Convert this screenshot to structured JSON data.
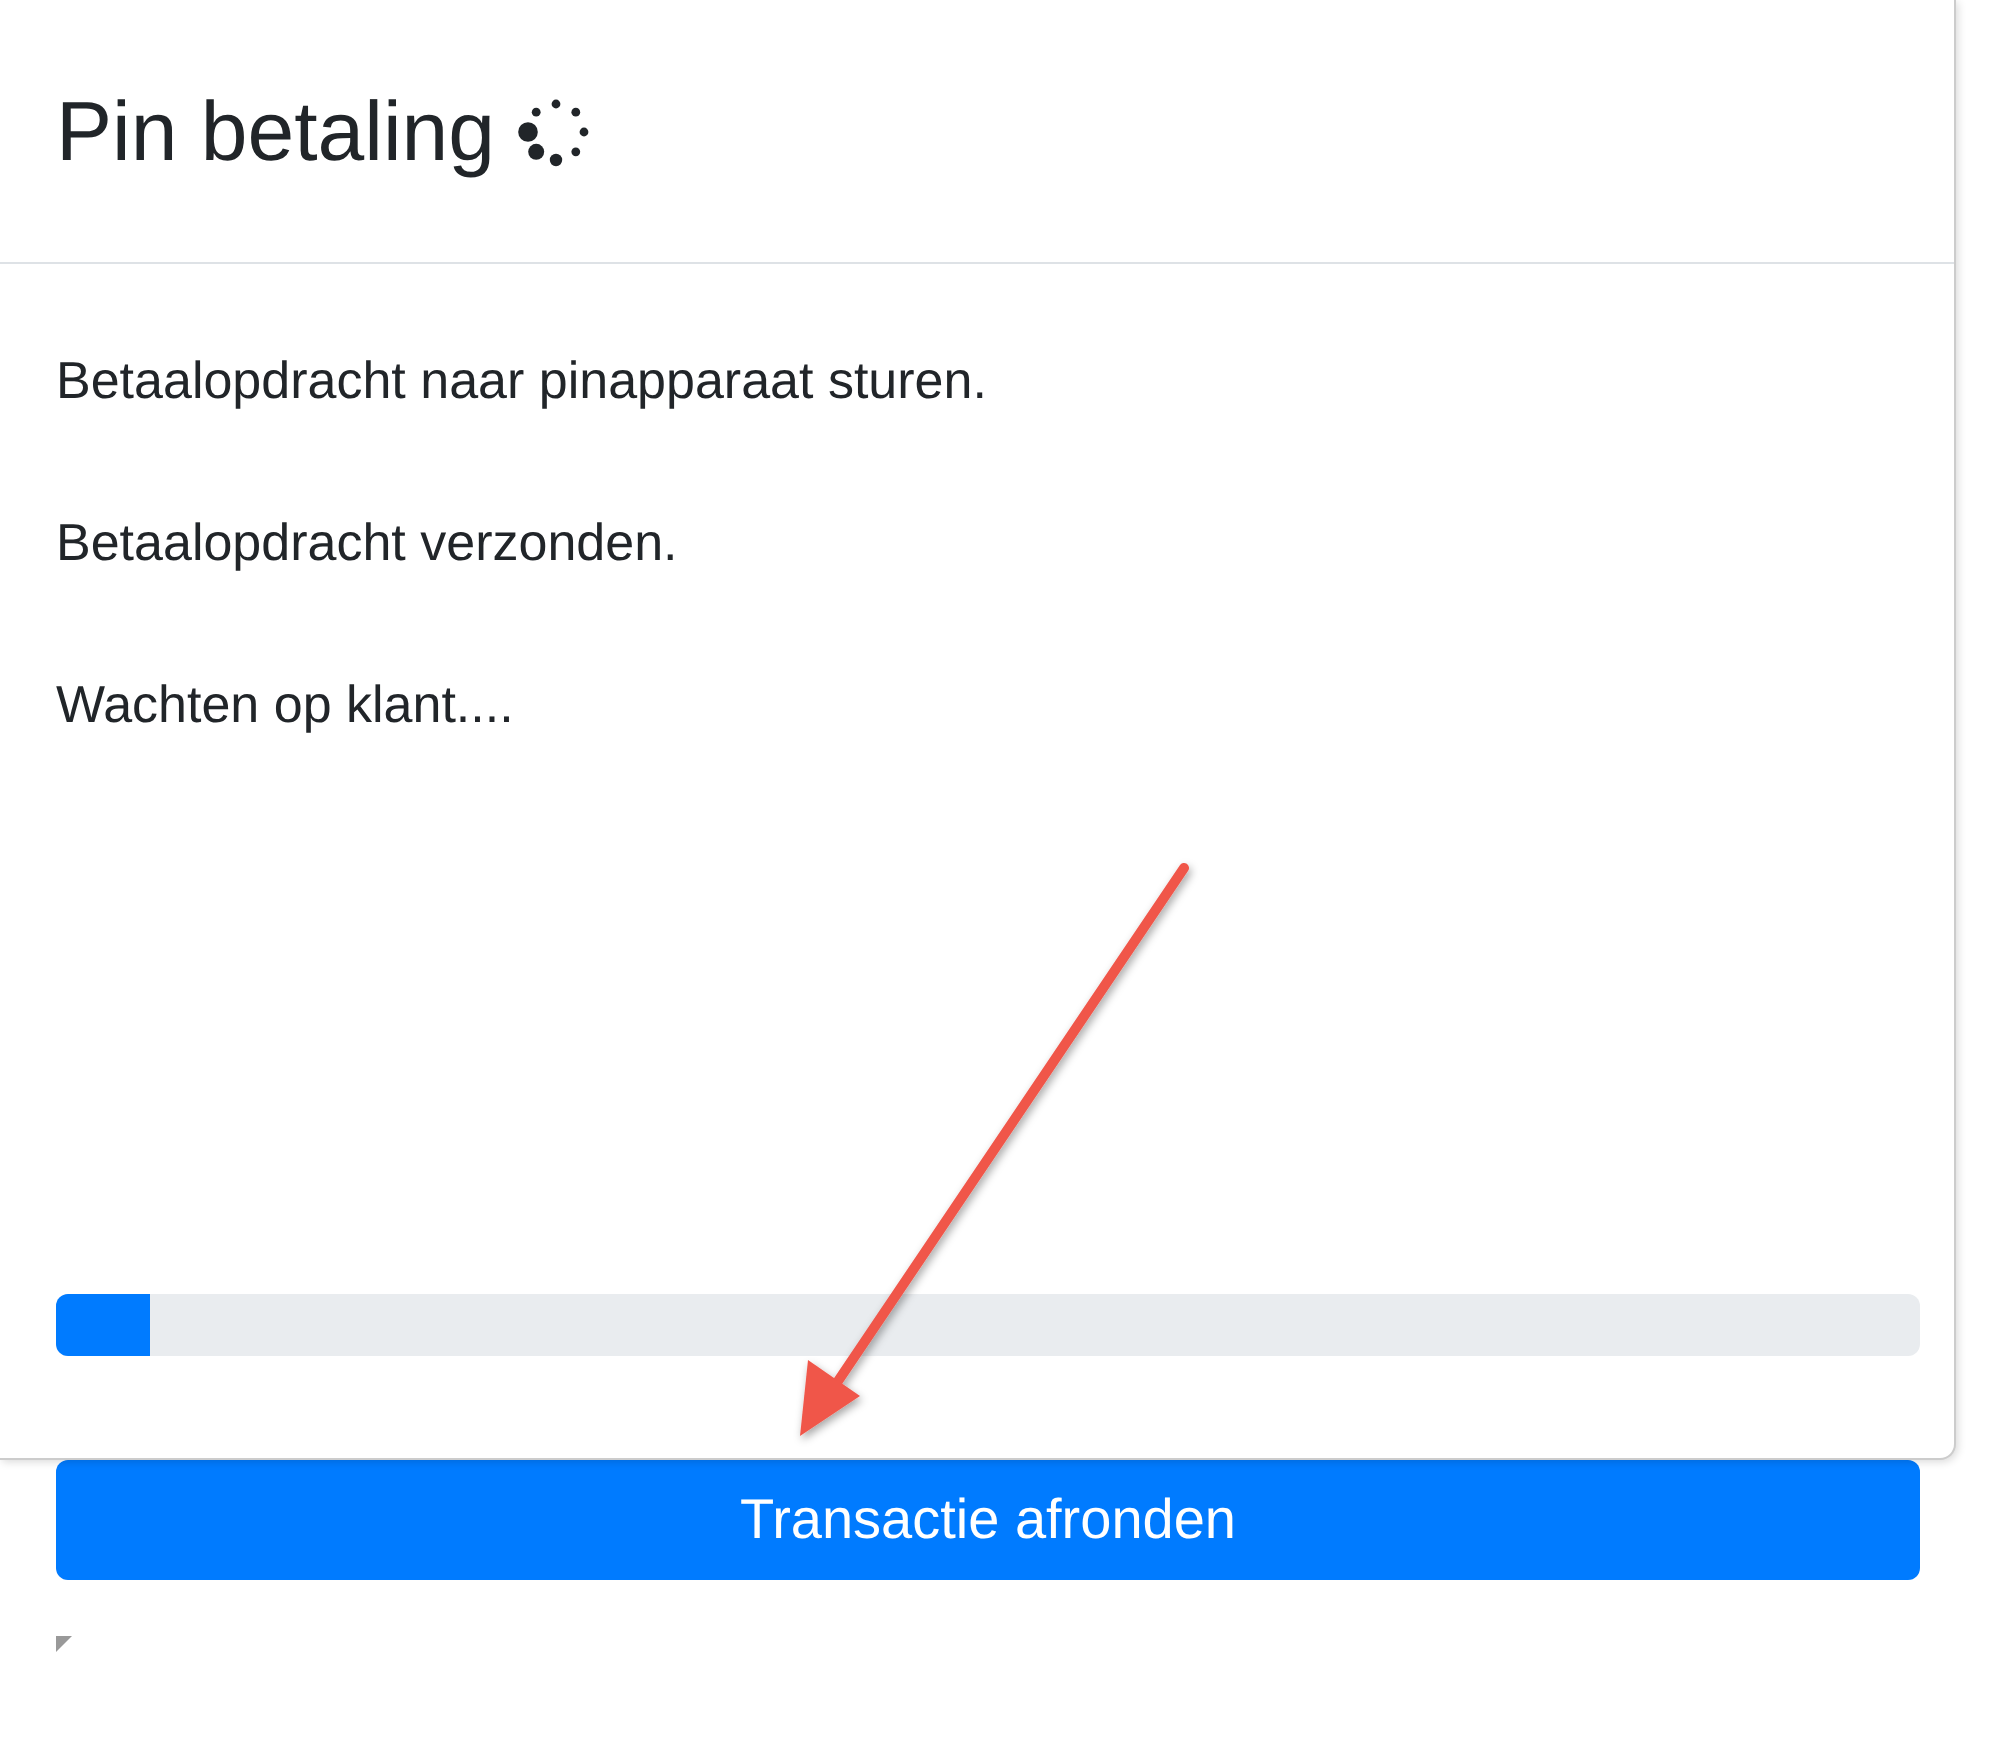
{
  "modal": {
    "title": "Pin betaling",
    "messages": [
      "Betaalopdracht naar pinapparaat sturen.",
      "Betaalopdracht verzonden.",
      "Wachten op klant...."
    ],
    "progress": {
      "level": 0.05
    }
  },
  "button": {
    "label": "Transactie afronden"
  }
}
